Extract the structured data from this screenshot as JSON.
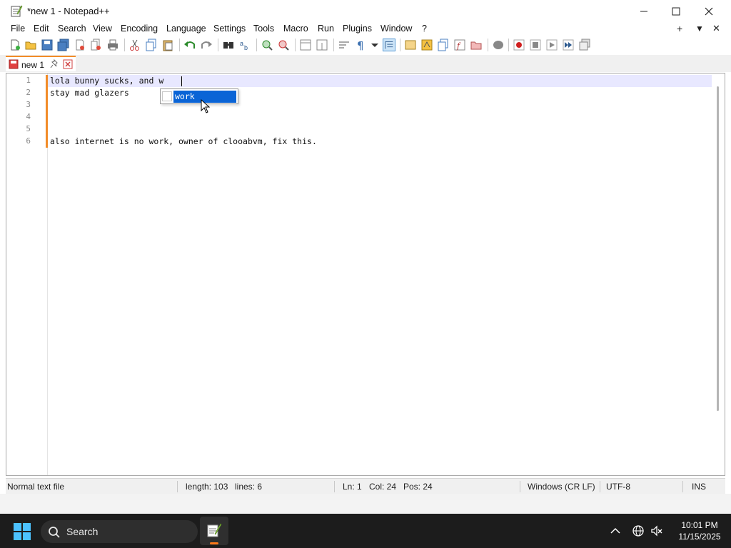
{
  "window": {
    "title": "*new 1 - Notepad++"
  },
  "menu": {
    "items": [
      "File",
      "Edit",
      "Search",
      "View",
      "Encoding",
      "Language",
      "Settings",
      "Tools",
      "Macro",
      "Run",
      "Plugins",
      "Window",
      "?"
    ],
    "right_controls": [
      "+",
      "▼",
      "✕"
    ]
  },
  "tab": {
    "label": "new 1",
    "icon": "save-disk-red-icon"
  },
  "editor": {
    "line_numbers": [
      "1",
      "2",
      "3",
      "4",
      "5",
      "6"
    ],
    "lines": [
      "lola bunny sucks, and w",
      "stay mad glazers",
      "",
      "",
      "",
      "also internet is no work, owner of clooabvm, fix this."
    ],
    "autocomplete": {
      "suggestion": "work"
    }
  },
  "statusbar": {
    "file_type": "Normal text file",
    "length": "length: 103",
    "lines": "lines: 6",
    "ln": "Ln: 1",
    "col": "Col: 24",
    "pos": "Pos: 24",
    "eol": "Windows (CR LF)",
    "encoding": "UTF-8",
    "mode": "INS"
  },
  "taskbar": {
    "search_label": "Search",
    "time": "10:01 PM",
    "date": "11/15/2025"
  },
  "colors": {
    "accent_orange": "#f28c28",
    "selection_blue": "#0a64d6",
    "taskbar_bg": "#1c1c1c"
  }
}
